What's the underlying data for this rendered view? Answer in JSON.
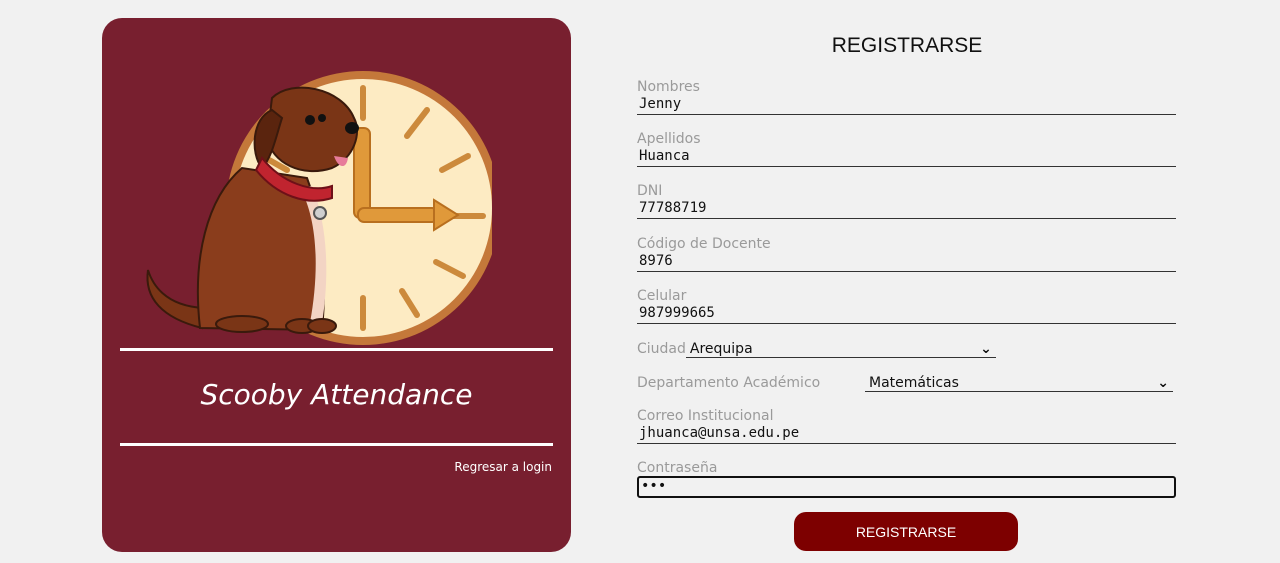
{
  "brand": {
    "app_name": "Scooby Attendance",
    "back_link": "Regresar a login"
  },
  "form": {
    "title": "REGISTRARSE",
    "fields": [
      {
        "label": "Nombres",
        "value": "Jenny"
      },
      {
        "label": "Apellidos",
        "value": "Huanca"
      },
      {
        "label": "DNI",
        "value": "77788719"
      },
      {
        "label": "Código de Docente",
        "value": "8976"
      },
      {
        "label": "Celular",
        "value": "987999665"
      }
    ],
    "ciudad": {
      "label": "Ciudad",
      "value": "Arequipa"
    },
    "departamento": {
      "label": "Departamento Académico",
      "value": "Matemáticas"
    },
    "correo": {
      "label": "Correo Institucional",
      "value": "jhuanca@unsa.edu.pe"
    },
    "password": {
      "label": "Contraseña",
      "value": "•••"
    },
    "submit_label": "REGISTRARSE"
  },
  "colors": {
    "card_bg": "#781f2f",
    "button_bg": "#7d0000",
    "page_bg": "#f1f1f1"
  },
  "icons": [
    "dog-clock-illustration",
    "chevron-down-icon"
  ]
}
